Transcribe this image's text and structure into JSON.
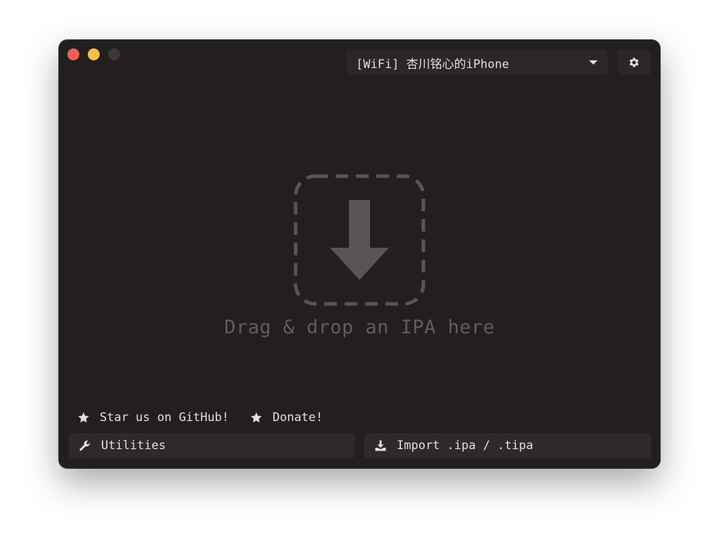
{
  "window": {
    "traffic_lights": [
      "close",
      "minimize",
      "maximize"
    ]
  },
  "header": {
    "device_select": {
      "value": "[WiFi] 杏川铭心的iPhone",
      "icon": "chevron-down-icon"
    },
    "settings_icon": "gear-icon"
  },
  "drop_zone": {
    "icon": "download-arrow-icon",
    "text": "Drag & drop an IPA here"
  },
  "links": {
    "github": {
      "label": "Star us on GitHub!",
      "icon": "star-icon"
    },
    "donate": {
      "label": "Donate!",
      "icon": "star-icon"
    }
  },
  "actions": {
    "utilities": {
      "label": "Utilities",
      "icon": "wrench-icon"
    },
    "import": {
      "label": "Import .ipa / .tipa",
      "icon": "download-icon"
    }
  },
  "colors": {
    "window_bg": "#231f1f",
    "button_bg": "#2f2a2a",
    "text": "#ebdcdc",
    "muted": "#625d5d",
    "close": "#ec5f57",
    "minimize": "#f4bf4f"
  }
}
